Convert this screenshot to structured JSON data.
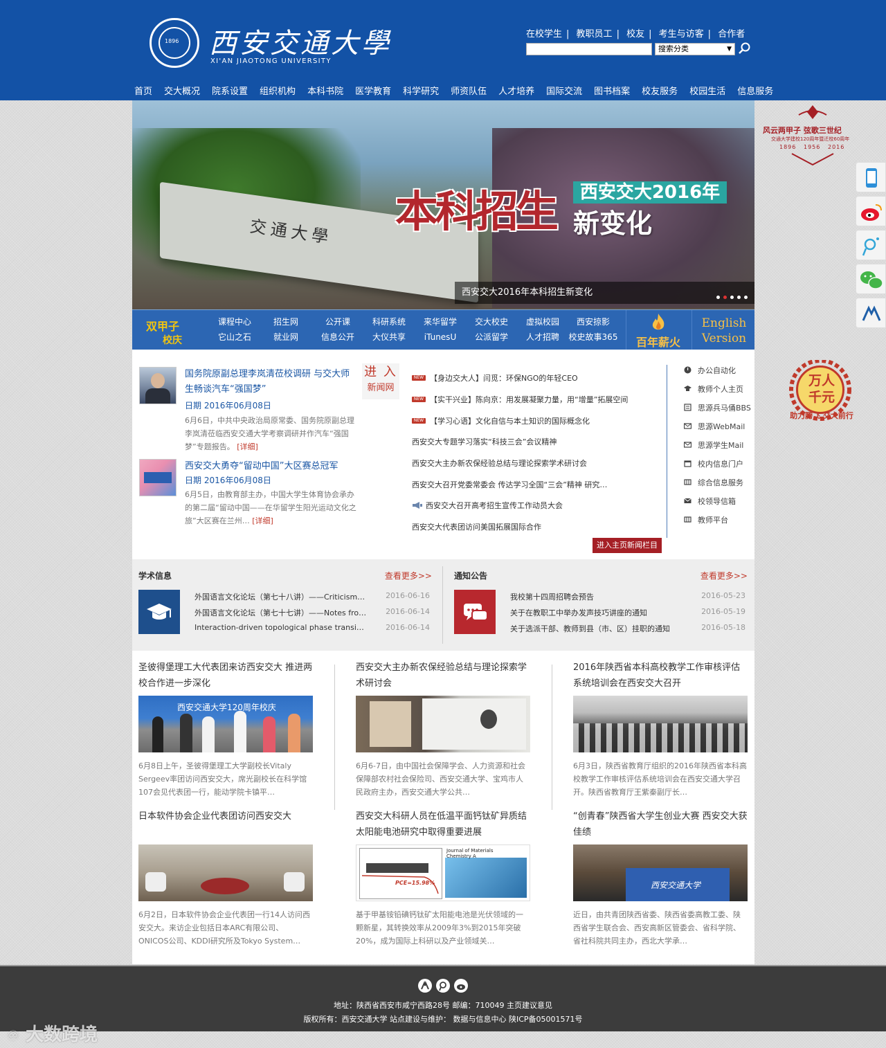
{
  "header": {
    "logo_cn": "西安交通大學",
    "logo_en": "XI'AN JIAOTONG UNIVERSITY",
    "seal_year": "1896",
    "top_links": [
      "在校学生",
      "教职员工",
      "校友",
      "考生与访客",
      "合作者"
    ],
    "search": {
      "placeholder": "",
      "select_value": "搜索分类"
    },
    "nav": [
      "首页",
      "交大概况",
      "院系设置",
      "组织机构",
      "本科书院",
      "医学教育",
      "科学研究",
      "师资队伍",
      "人才培养",
      "国际交流",
      "图书档案",
      "校友服务",
      "校园生活",
      "信息服务"
    ]
  },
  "banner": {
    "gate_text": "交通大學",
    "big_text": "本科招生",
    "tag_text": "西安交大2016年",
    "sub_text": "新变化",
    "caption": "西安交大2016年本科招生新变化",
    "dots": 5,
    "active_dot": 1
  },
  "quickbar": {
    "jiazi_line1": "双甲子",
    "jiazi_line2": "校庆",
    "columns": [
      [
        "课程中心",
        "它山之石"
      ],
      [
        "招生网",
        "就业网"
      ],
      [
        "公开课",
        "信息公开"
      ],
      [
        "科研系统",
        "大仪共享"
      ],
      [
        "来华留学",
        "iTunesU"
      ],
      [
        "交大校史",
        "公派留学"
      ],
      [
        "虚拟校园",
        "人才招聘"
      ],
      [
        "西安掠影",
        "校史故事365"
      ]
    ],
    "fire_text": "百年薪火",
    "english_line1": "English",
    "english_line2": "Version"
  },
  "news": {
    "featured": [
      {
        "title": "国务院原副总理李岚清莅校调研 与交大师生畅谈汽车“强国梦”",
        "date": "日期 2016年06月08日",
        "desc": "6月6日，中共中央政治局原常委、国务院原副总理李岚清莅临西安交通大学考察调研并作汽车“强国梦”专题报告。",
        "more": "[详细]"
      },
      {
        "title": "西安交大勇夺“留动中国”大区赛总冠军",
        "date": "日期 2016年06月08日",
        "desc": "6月5日，由教育部主办，中国大学生体育协会承办的第二届“留动中国——在华留学生阳光运动文化之旅”大区赛在兰州…",
        "more": "[详细]"
      }
    ],
    "enter_line1": "进 入",
    "enter_line2": "新闻网",
    "badge": "NEW",
    "items": [
      "【身边交大人】闫觅：环保NGO的年轻CEO",
      "【实干兴业】陈向京：用发展凝聚力量，用“增量”拓展空间",
      "【学习心语】文化自信与本土知识的国际概念化",
      "西安交大专题学习落实“科技三会”会议精神",
      "西安交大主办新农保经验总结与理论探索学术研讨会",
      "西安交大召开党委常委会 传达学习全国“三会”精神 研究…",
      "西安交大召开高考招生宣传工作动员大会",
      "西安交大代表团访问美国拓展国际合作"
    ],
    "enter_column": "进入主页新闻栏目"
  },
  "side_links": [
    "办公自动化",
    "教师个人主页",
    "思源兵马俑BBS",
    "思源WebMail",
    "思源学生Mail",
    "校内信息门户",
    "综合信息服务",
    "校领导信箱",
    "教师平台"
  ],
  "academic": {
    "title": "学术信息",
    "more": "查看更多>>",
    "rows": [
      {
        "text": "外国语言文化论坛（第七十八讲）——Criticism…",
        "date": "2016-06-16"
      },
      {
        "text": "外国语言文化论坛（第七十七讲）——Notes fro…",
        "date": "2016-06-14"
      },
      {
        "text": "Interaction-driven topological phase transi…",
        "date": "2016-06-14"
      }
    ]
  },
  "notice": {
    "title": "通知公告",
    "more": "查看更多>>",
    "rows": [
      {
        "text": "我校第十四周招聘会预告",
        "date": "2016-05-23"
      },
      {
        "text": "关于在教职工中举办发声技巧讲座的通知",
        "date": "2016-05-19"
      },
      {
        "text": "关于选派干部、教师到县（市、区）挂职的通知",
        "date": "2016-05-18"
      }
    ]
  },
  "bottom_news": [
    {
      "title": "圣彼得堡理工大代表团来访西安交大 推进两校合作进一步深化",
      "img_text": "西安交通大学120周年校庆",
      "desc": "6月8日上午，圣彼得堡理工大学副校长Vitaly Sergeev率团访问西安交大，席光副校长在科学馆107会见代表团一行，能动学院卡镇平…"
    },
    {
      "title": "西安交大主办新农保经验总结与理论探索学术研讨会",
      "img_text": "",
      "desc": "6月6-7日，由中国社会保障学会、人力资源和社会保障部农村社会保险司、西安交通大学、宝鸡市人民政府主办，西安交通大学公共…"
    },
    {
      "title": "2016年陕西省本科高校教学工作审核评估系统培训会在西安交大召开",
      "img_text": "",
      "desc": "6月3日，陕西省教育厅组织的2016年陕西省本科高校教学工作审核评估系统培训会在西安交通大学召开。陕西省教育厅王紫秦副厅长…"
    },
    {
      "title": "日本软件协会企业代表团访问西安交大",
      "img_text": "",
      "desc": "6月2日，日本软件协会企业代表团一行14人访问西安交大。来访企业包括日本ARC有限公司、ONICOS公司、KDDI研究所及Tokyo System…"
    },
    {
      "title": "西安交大科研人员在低温平面钙钛矿异质结太阳能电池研究中取得重要进展",
      "img_text": "Journal of Materials Chemistry A",
      "img_text2": "PCE=15.98%",
      "desc": "基于甲基铵铅碘钙钛矿太阳能电池是光伏领域的一颗新星，其转换效率从2009年3%到2015年突破20%，成为国际上科研以及产业领域关…"
    },
    {
      "title": "“创青春”陕西省大学生创业大赛 西安交大获佳绩",
      "img_text": "西安交通大学",
      "desc": "近日，由共青团陕西省委、陕西省委高教工委、陕西省学生联合会、西安高新区管委会、省科学院、省社科院共同主办，西北大学承…"
    }
  ],
  "footer": {
    "address": "地址：陕西省西安市咸宁西路28号 邮编：710049 主页建议意见",
    "copyright": "版权所有：西安交通大学 站点建设与维护： 数据与信息中心 陕ICP备05001571号",
    "watermark": "大数跨境"
  },
  "side_widgets": {
    "anniv_line1": "风云两甲子 弦歌三世纪",
    "anniv_line2": "交通大学建校120周年暨迁校60周年",
    "anniv_years": [
      "1896",
      "1956",
      "2016"
    ],
    "wanren": "万人千元",
    "wanren_ring": "助力腾飞 交大前行"
  },
  "colors": {
    "brand_blue": "#1352a6",
    "quickbar_blue": "#2c66b3",
    "accent_red": "#a51f25",
    "gold": "#f7c046"
  }
}
